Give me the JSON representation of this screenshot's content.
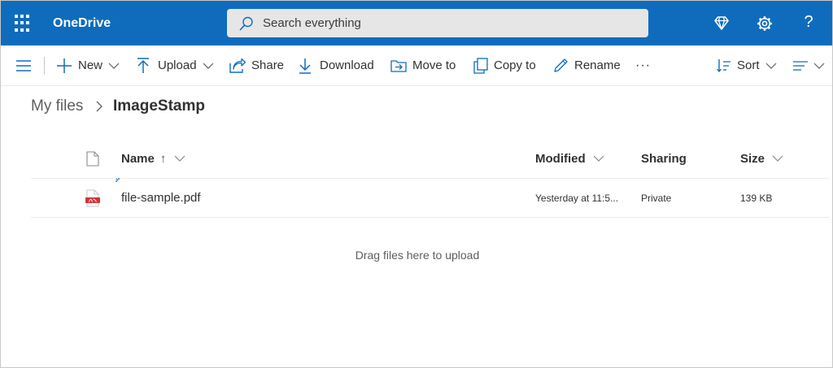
{
  "header": {
    "app_name": "OneDrive",
    "search_placeholder": "Search everything",
    "help_label": "?"
  },
  "commands": {
    "new": "New",
    "upload": "Upload",
    "share": "Share",
    "download": "Download",
    "move_to": "Move to",
    "copy_to": "Copy to",
    "rename": "Rename",
    "more": "···",
    "sort": "Sort"
  },
  "breadcrumb": {
    "root": "My files",
    "current": "ImageStamp"
  },
  "columns": {
    "name": "Name",
    "name_sort_indicator": "↑",
    "modified": "Modified",
    "sharing": "Sharing",
    "size": "Size"
  },
  "files": [
    {
      "name": "file-sample.pdf",
      "modified": "Yesterday at 11:5...",
      "sharing": "Private",
      "size": "139 KB",
      "icon": "pdf-file-icon"
    }
  ],
  "drop_hint": "Drag files here to upload",
  "colors": {
    "suitebar": "#0f6cbd",
    "accent": "#0f6cbd",
    "pdf": "#d13438"
  }
}
